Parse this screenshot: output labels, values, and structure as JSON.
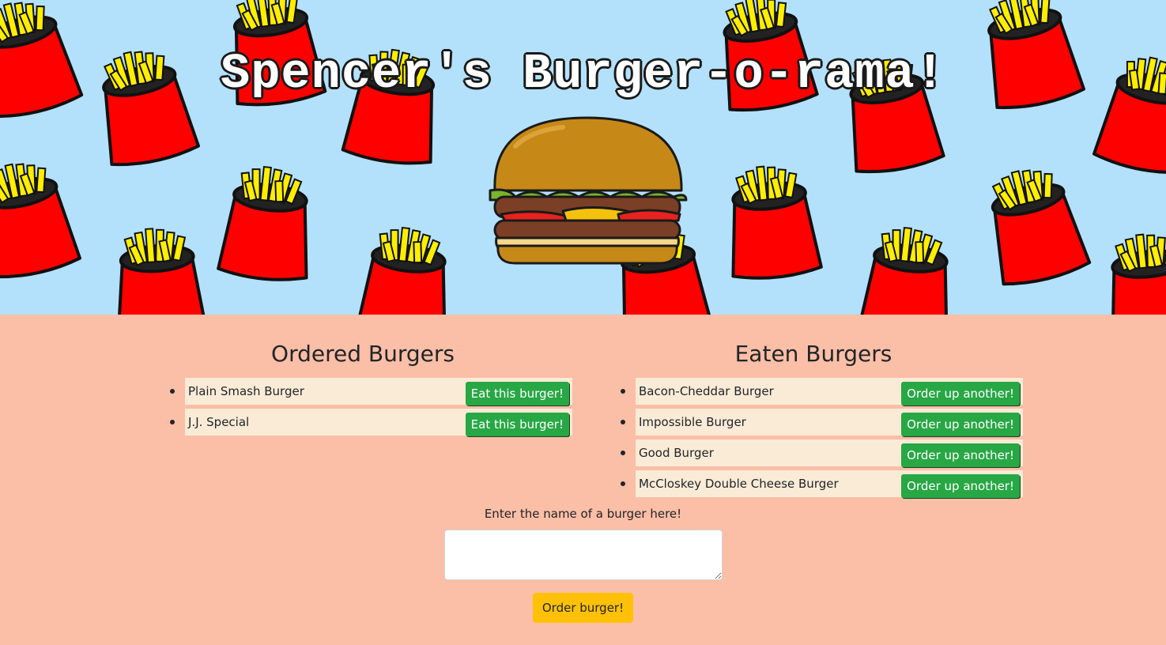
{
  "header": {
    "title": "Spencer's Burger-o-rama!"
  },
  "ordered": {
    "heading": "Ordered Burgers",
    "button_label": "Eat this burger!",
    "items": [
      {
        "name": "Plain Smash Burger"
      },
      {
        "name": "J.J. Special"
      }
    ]
  },
  "eaten": {
    "heading": "Eaten Burgers",
    "button_label": "Order up another!",
    "items": [
      {
        "name": "Bacon-Cheddar Burger"
      },
      {
        "name": "Impossible Burger"
      },
      {
        "name": "Good Burger"
      },
      {
        "name": "McCloskey Double Cheese Burger"
      }
    ]
  },
  "form": {
    "label": "Enter the name of a burger here!",
    "input_value": "",
    "submit_label": "Order burger!"
  },
  "colors": {
    "hero_background": "#b3e1fc",
    "page_background": "#fbbea6",
    "row_background": "#faebd7",
    "eat_button": "#28a745",
    "order_button": "#ffc107",
    "fries_cup": "#ff0000",
    "fries": "#ffee00"
  },
  "icons": {
    "hero_pattern": "french-fries-icon",
    "logo": "hamburger-icon"
  }
}
